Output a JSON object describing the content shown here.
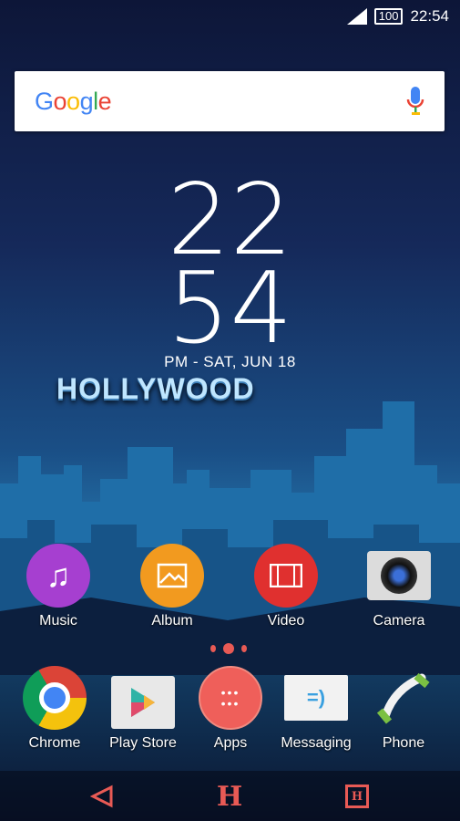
{
  "status_bar": {
    "signal_icon": "signal-icon",
    "battery_level": "100",
    "time": "22:54"
  },
  "search": {
    "logo": "Google",
    "mic_icon": "mic-icon"
  },
  "clock": {
    "hours": "22",
    "minutes": "54",
    "date": "PM - SAT, JUN 18"
  },
  "wallpaper": {
    "text": "HOLLYWOOD"
  },
  "home_apps": [
    {
      "label": "Music",
      "icon": "music-icon",
      "color": "#a63fd0"
    },
    {
      "label": "Album",
      "icon": "album-icon",
      "color": "#f29a1f"
    },
    {
      "label": "Video",
      "icon": "video-icon",
      "color": "#e0302f"
    },
    {
      "label": "Camera",
      "icon": "camera-icon",
      "color": "#dcdcdc"
    }
  ],
  "page_indicator": {
    "pages": 3,
    "current": 2
  },
  "dock": [
    {
      "label": "Chrome",
      "icon": "chrome-icon"
    },
    {
      "label": "Play Store",
      "icon": "play-store-icon"
    },
    {
      "label": "Apps",
      "icon": "apps-icon",
      "color": "#ef5f5a"
    },
    {
      "label": "Messaging",
      "icon": "messaging-icon"
    },
    {
      "label": "Phone",
      "icon": "phone-icon"
    }
  ],
  "nav": {
    "back": "back-icon",
    "home": "H",
    "recents": "H",
    "accent": "#e85a55"
  }
}
